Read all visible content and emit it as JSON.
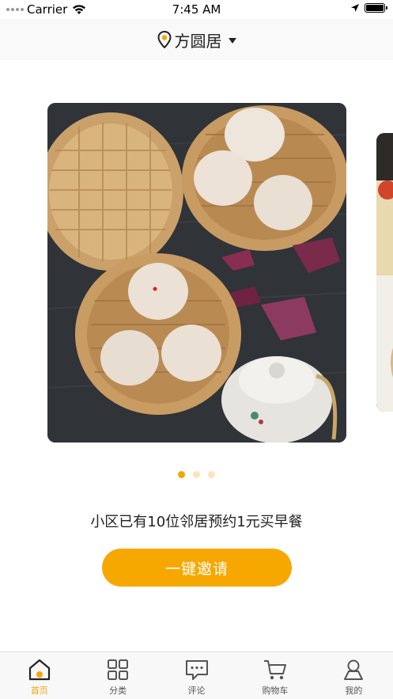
{
  "status_bar": {
    "carrier": "Carrier",
    "time": "7:45 AM",
    "battery_level": 1.0
  },
  "header": {
    "location": "方圆居",
    "location_icon": "map-pin-icon",
    "dropdown_icon": "caret-down-icon"
  },
  "carousel": {
    "page_count": 3,
    "active_index": 0
  },
  "promo": {
    "text": "小区已有10位邻居预约1元买早餐",
    "button_label": "一键邀请"
  },
  "tabbar": {
    "items": [
      {
        "label": "首页",
        "icon": "home-icon",
        "active": true
      },
      {
        "label": "分类",
        "icon": "grid-icon",
        "active": false
      },
      {
        "label": "评论",
        "icon": "comment-icon",
        "active": false
      },
      {
        "label": "购物车",
        "icon": "cart-icon",
        "active": false
      },
      {
        "label": "我的",
        "icon": "user-icon",
        "active": false
      }
    ]
  },
  "colors": {
    "accent": "#f7a800",
    "accent_light": "#fde3b8",
    "tab_active": "#f7a500"
  }
}
